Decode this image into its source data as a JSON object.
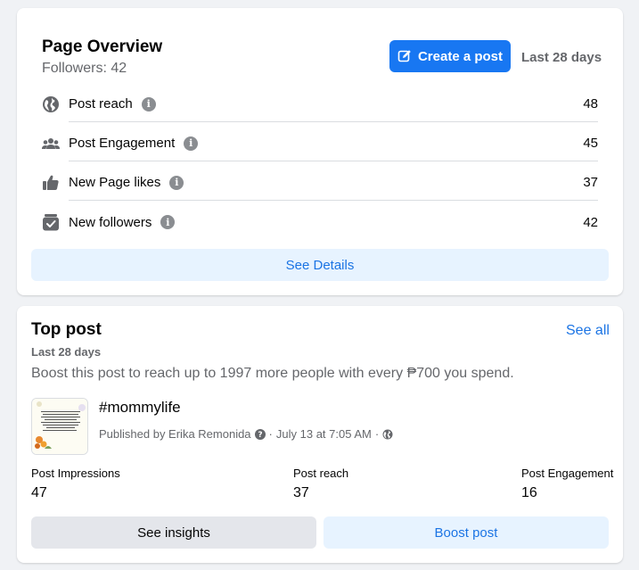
{
  "overview": {
    "title": "Page Overview",
    "followers": "Followers: 42",
    "create_post_label": "Create a post",
    "range": "Last 28 days",
    "metrics": [
      {
        "label": "Post reach",
        "value": "48",
        "icon": "globe-icon"
      },
      {
        "label": "Post Engagement",
        "value": "45",
        "icon": "people-icon"
      },
      {
        "label": "New Page likes",
        "value": "37",
        "icon": "thumbs-up-icon"
      },
      {
        "label": "New followers",
        "value": "42",
        "icon": "follow-check-icon"
      }
    ],
    "details_label": "See Details"
  },
  "top_post": {
    "title": "Top post",
    "range": "Last 28 days",
    "see_all": "See all",
    "boost_text": "Boost this post to reach up to 1997 more people with every ₱700 you spend.",
    "post_title": "#mommylife",
    "published_by": "Published by Erika Remonida",
    "date": "July 13 at 7:05 AM",
    "stats": [
      {
        "label": "Post Impressions",
        "value": "47"
      },
      {
        "label": "Post reach",
        "value": "37"
      },
      {
        "label": "Post Engagement",
        "value": "16"
      }
    ],
    "insights_label": "See insights",
    "boost_label": "Boost post"
  },
  "colors": {
    "accent": "#1877f2",
    "link": "#1b74e4",
    "secondary_text": "#65676b",
    "light_button": "#e7f3ff"
  }
}
